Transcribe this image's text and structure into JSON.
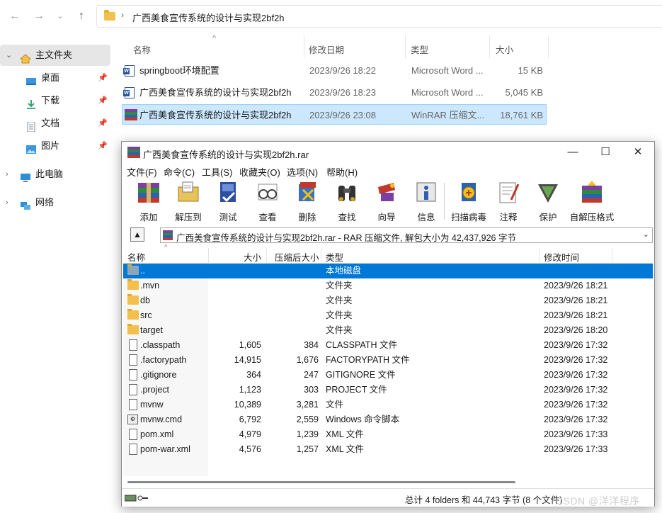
{
  "explorer": {
    "path": "广西美食宣传系统的设计与实现2bf2h",
    "sidebar": [
      {
        "label": "主文件夹"
      },
      {
        "label": "桌面"
      },
      {
        "label": "下载"
      },
      {
        "label": "文档"
      },
      {
        "label": "图片"
      },
      {
        "label": "此电脑"
      },
      {
        "label": "网络"
      }
    ],
    "columns": {
      "name": "名称",
      "date": "修改日期",
      "type": "类型",
      "size": "大小"
    },
    "files": [
      {
        "name": "springboot环境配置",
        "date": "2023/9/26 18:22",
        "type": "Microsoft Word ...",
        "size": "15 KB"
      },
      {
        "name": "广西美食宣传系统的设计与实现2bf2h",
        "date": "2023/9/26 18:23",
        "type": "Microsoft Word ...",
        "size": "5,045 KB"
      },
      {
        "name": "广西美食宣传系统的设计与实现2bf2h",
        "date": "2023/9/26 23:08",
        "type": "WinRAR 压缩文...",
        "size": "18,761 KB"
      }
    ]
  },
  "winrar": {
    "title": "广西美食宣传系统的设计与实现2bf2h.rar",
    "menus": [
      "文件(F)",
      "命令(C)",
      "工具(S)",
      "收藏夹(O)",
      "选项(N)",
      "帮助(H)"
    ],
    "tools": [
      "添加",
      "解压到",
      "测试",
      "查看",
      "删除",
      "查找",
      "向导",
      "信息",
      "扫描病毒",
      "注释",
      "保护",
      "自解压格式"
    ],
    "path_text": "广西美食宣传系统的设计与实现2bf2h.rar - RAR 压缩文件, 解包大小为 42,437,926 字节",
    "columns": {
      "name": "名称",
      "size": "大小",
      "packed": "压缩后大小",
      "type": "类型",
      "modified": "修改时间"
    },
    "rows": [
      {
        "name": "..",
        "size": "",
        "packed": "",
        "type": "本地磁盘",
        "modified": ""
      },
      {
        "name": ".mvn",
        "size": "",
        "packed": "",
        "type": "文件夹",
        "modified": "2023/9/26 18:21"
      },
      {
        "name": "db",
        "size": "",
        "packed": "",
        "type": "文件夹",
        "modified": "2023/9/26 18:21"
      },
      {
        "name": "src",
        "size": "",
        "packed": "",
        "type": "文件夹",
        "modified": "2023/9/26 18:21"
      },
      {
        "name": "target",
        "size": "",
        "packed": "",
        "type": "文件夹",
        "modified": "2023/9/26 18:20"
      },
      {
        "name": ".classpath",
        "size": "1,605",
        "packed": "384",
        "type": "CLASSPATH 文件",
        "modified": "2023/9/26 17:32"
      },
      {
        "name": ".factorypath",
        "size": "14,915",
        "packed": "1,676",
        "type": "FACTORYPATH 文件",
        "modified": "2023/9/26 17:32"
      },
      {
        "name": ".gitignore",
        "size": "364",
        "packed": "247",
        "type": "GITIGNORE 文件",
        "modified": "2023/9/26 17:32"
      },
      {
        "name": ".project",
        "size": "1,123",
        "packed": "303",
        "type": "PROJECT 文件",
        "modified": "2023/9/26 17:32"
      },
      {
        "name": "mvnw",
        "size": "10,389",
        "packed": "3,281",
        "type": "文件",
        "modified": "2023/9/26 17:32"
      },
      {
        "name": "mvnw.cmd",
        "size": "6,792",
        "packed": "2,559",
        "type": "Windows 命令脚本",
        "modified": "2023/9/26 17:32"
      },
      {
        "name": "pom.xml",
        "size": "4,979",
        "packed": "1,239",
        "type": "XML 文件",
        "modified": "2023/9/26 17:33"
      },
      {
        "name": "pom-war.xml",
        "size": "4,576",
        "packed": "1,257",
        "type": "XML 文件",
        "modified": "2023/9/26 17:33"
      }
    ],
    "status": "总计 4 folders 和 44,743 字节 (8 个文件)"
  },
  "watermark": "CSDN @洋洋程序"
}
